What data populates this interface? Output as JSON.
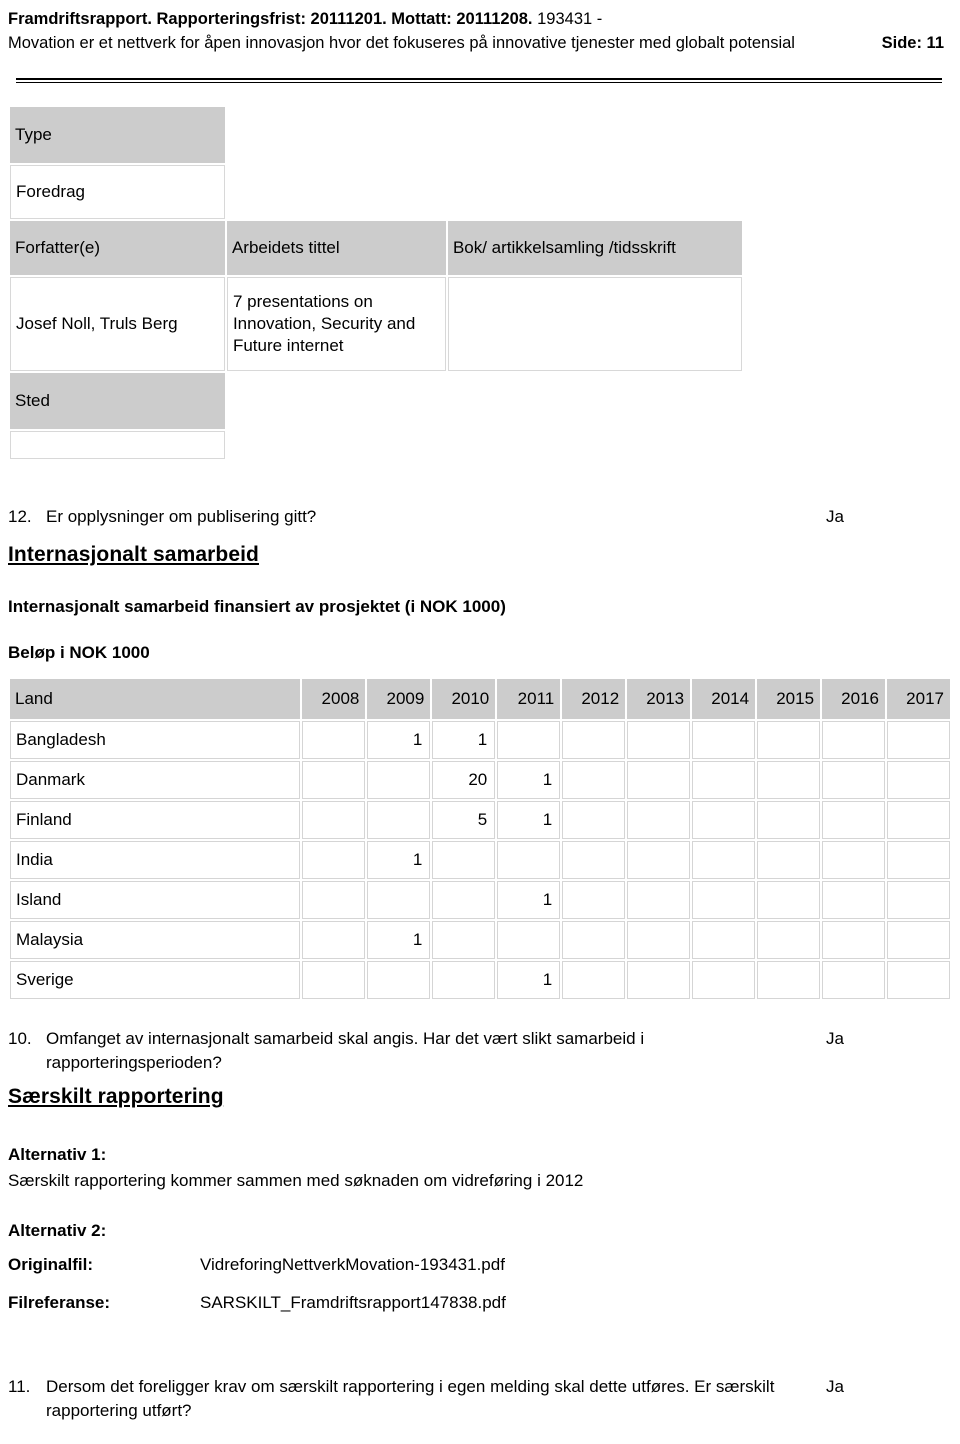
{
  "header": {
    "title_bold": "Framdriftsrapport. Rapporteringsfrist: 20111201. Mottatt: 20111208.",
    "title_id": "193431 -",
    "subtitle": "Movation er et nettverk for åpen innovasjon hvor det fokuseres på innovative tjenester med globalt potensial",
    "page_label": "Side: 11"
  },
  "publication": {
    "type_header": "Type",
    "type_value": "Foredrag",
    "col_author": "Forfatter(e)",
    "col_title": "Arbeidets tittel",
    "col_book": "Bok/ artikkelsamling /tidsskrift",
    "author_value": "Josef Noll, Truls Berg",
    "title_value": "7 presentations on Innovation, Security and Future internet",
    "book_value": "",
    "sted_header": "Sted",
    "sted_value": ""
  },
  "question_12": {
    "number": "12.",
    "text": "Er opplysninger om publisering gitt?",
    "answer": "Ja"
  },
  "international": {
    "section_title": "Internasjonalt samarbeid",
    "subtitle": "Internasjonalt samarbeid finansiert av prosjektet (i NOK 1000)",
    "amount_label": "Beløp i NOK 1000"
  },
  "chart_data": {
    "type": "table",
    "title": "Internasjonalt samarbeid finansiert av prosjektet (i NOK 1000)",
    "land_header": "Land",
    "years": [
      "2008",
      "2009",
      "2010",
      "2011",
      "2012",
      "2013",
      "2014",
      "2015",
      "2016",
      "2017"
    ],
    "rows": [
      {
        "land": "Bangladesh",
        "values": [
          "",
          "1",
          "1",
          "",
          "",
          "",
          "",
          "",
          "",
          ""
        ]
      },
      {
        "land": "Danmark",
        "values": [
          "",
          "",
          "20",
          "1",
          "",
          "",
          "",
          "",
          "",
          ""
        ]
      },
      {
        "land": "Finland",
        "values": [
          "",
          "",
          "5",
          "1",
          "",
          "",
          "",
          "",
          "",
          ""
        ]
      },
      {
        "land": "India",
        "values": [
          "",
          "1",
          "",
          "",
          "",
          "",
          "",
          "",
          "",
          ""
        ]
      },
      {
        "land": "Island",
        "values": [
          "",
          "",
          "",
          "1",
          "",
          "",
          "",
          "",
          "",
          ""
        ]
      },
      {
        "land": "Malaysia",
        "values": [
          "",
          "1",
          "",
          "",
          "",
          "",
          "",
          "",
          "",
          ""
        ]
      },
      {
        "land": "Sverige",
        "values": [
          "",
          "",
          "",
          "1",
          "",
          "",
          "",
          "",
          "",
          ""
        ]
      }
    ]
  },
  "question_10": {
    "number": "10.",
    "text": "Omfanget av internasjonalt samarbeid skal angis. Har det vært slikt samarbeid i rapporteringsperioden?",
    "answer": "Ja"
  },
  "special": {
    "section_title": "Særskilt rapportering",
    "alt1_label": "Alternativ 1:",
    "alt1_text": "Særskilt rapportering kommer sammen med søknaden om vidreføring i 2012",
    "alt2_label": "Alternativ 2:",
    "original_key": "Originalfil:",
    "original_value": "VidreforingNettverkMovation-193431.pdf",
    "reference_key": "Filreferanse:",
    "reference_value": "SARSKILT_Framdriftsrapport147838.pdf"
  },
  "question_11": {
    "number": "11.",
    "text": "Dersom det foreligger krav om særskilt rapportering i egen melding skal dette utføres. Er særskilt rapportering utført?",
    "answer": "Ja"
  },
  "colors": {
    "header_shade": "#cccccc",
    "cell_border": "#d5d5d5",
    "text": "#000000"
  }
}
